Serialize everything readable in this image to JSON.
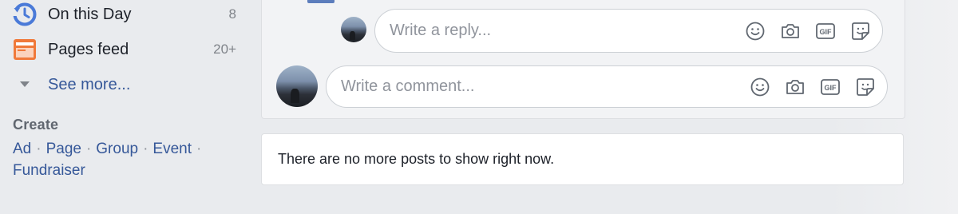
{
  "sidebar": {
    "items": [
      {
        "label": "On this Day",
        "count": "8",
        "icon": "clock-history-icon"
      },
      {
        "label": "Pages feed",
        "count": "20+",
        "icon": "pages-feed-icon"
      }
    ],
    "see_more": {
      "label": "See more...",
      "icon": "chevron-down-icon"
    },
    "create": {
      "heading": "Create",
      "links": [
        "Ad",
        "Page",
        "Group",
        "Event",
        "Fundraiser"
      ],
      "separator": "·"
    }
  },
  "post": {
    "reply_box": {
      "placeholder": "Write a reply...",
      "tools": [
        "emoji-icon",
        "camera-icon",
        "gif-icon",
        "sticker-icon"
      ]
    },
    "comment_box": {
      "placeholder": "Write a comment...",
      "tools": [
        "emoji-icon",
        "camera-icon",
        "gif-icon",
        "sticker-icon"
      ]
    }
  },
  "feed_end": {
    "message": "There are no more posts to show right now."
  },
  "colors": {
    "background": "#e9ebee",
    "link": "#365899",
    "text": "#1d2129",
    "muted": "#90949c",
    "clock_blue": "#4a7ad8",
    "pages_orange": "#f0793a"
  }
}
